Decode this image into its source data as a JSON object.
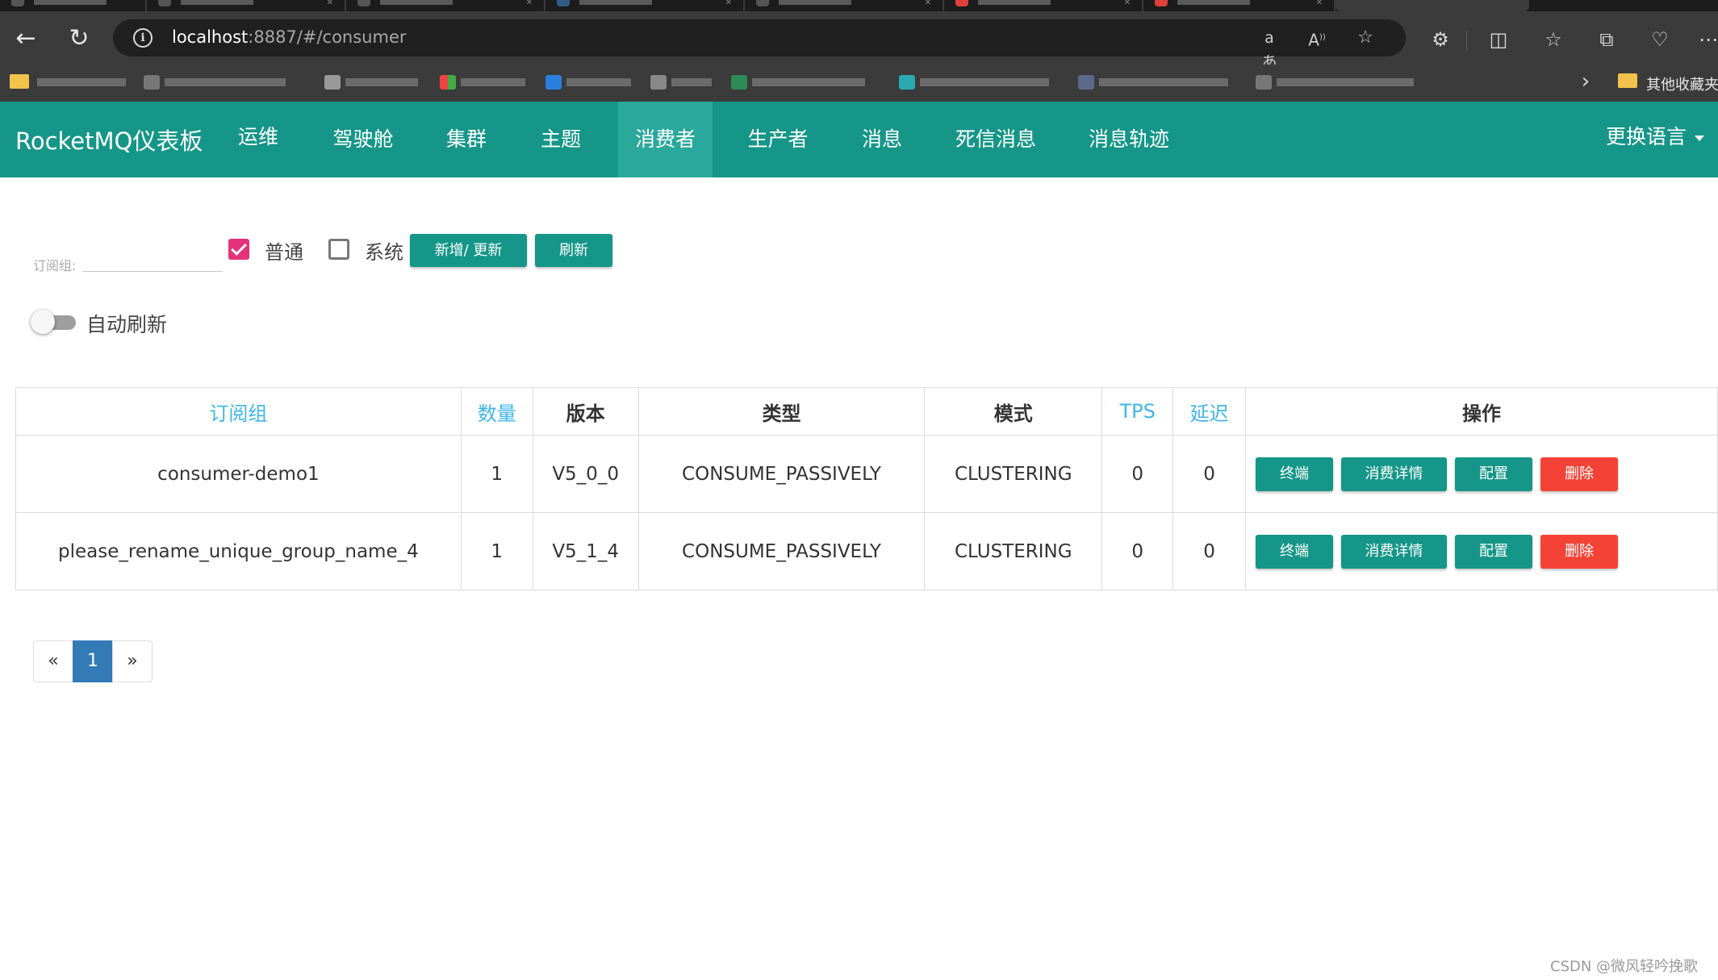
{
  "browser": {
    "url_host": "localhost",
    "url_rest": ":8887/#/consumer",
    "other_bookmarks": "其他收藏夹"
  },
  "navbar": {
    "brand": "RocketMQ仪表板",
    "items": [
      "运维",
      "驾驶舱",
      "集群",
      "主题",
      "消费者",
      "生产者",
      "消息",
      "死信消息",
      "消息轨迹"
    ],
    "active": "消费者",
    "language": "更换语言"
  },
  "filter": {
    "label": "订阅组:",
    "input_value": "",
    "normal_label": "普通",
    "normal_checked": true,
    "system_label": "系统",
    "system_checked": false,
    "add_button": "新增/ 更新",
    "refresh_button": "刷新",
    "auto_refresh_label": "自动刷新",
    "auto_refresh_on": false
  },
  "table": {
    "headers": [
      "订阅组",
      "数量",
      "版本",
      "类型",
      "模式",
      "TPS",
      "延迟",
      "操作"
    ],
    "rows": [
      {
        "group": "consumer-demo1",
        "count": "1",
        "version": "V5_0_0",
        "type": "CONSUME_PASSIVELY",
        "mode": "CLUSTERING",
        "tps": "0",
        "delay": "0"
      },
      {
        "group": "please_rename_unique_group_name_4",
        "count": "1",
        "version": "V5_1_4",
        "type": "CONSUME_PASSIVELY",
        "mode": "CLUSTERING",
        "tps": "0",
        "delay": "0"
      }
    ],
    "actions": [
      "终端",
      "消费详情",
      "配置",
      "删除"
    ]
  },
  "pagination": {
    "prev": "«",
    "current": "1",
    "next": "»"
  },
  "watermark": "CSDN @微风轻吟挽歌",
  "colors": {
    "primary": "#159688",
    "danger": "#f44336",
    "link": "#3fb5e8",
    "checkbox": "#e4317a",
    "page_active": "#337ab7"
  }
}
